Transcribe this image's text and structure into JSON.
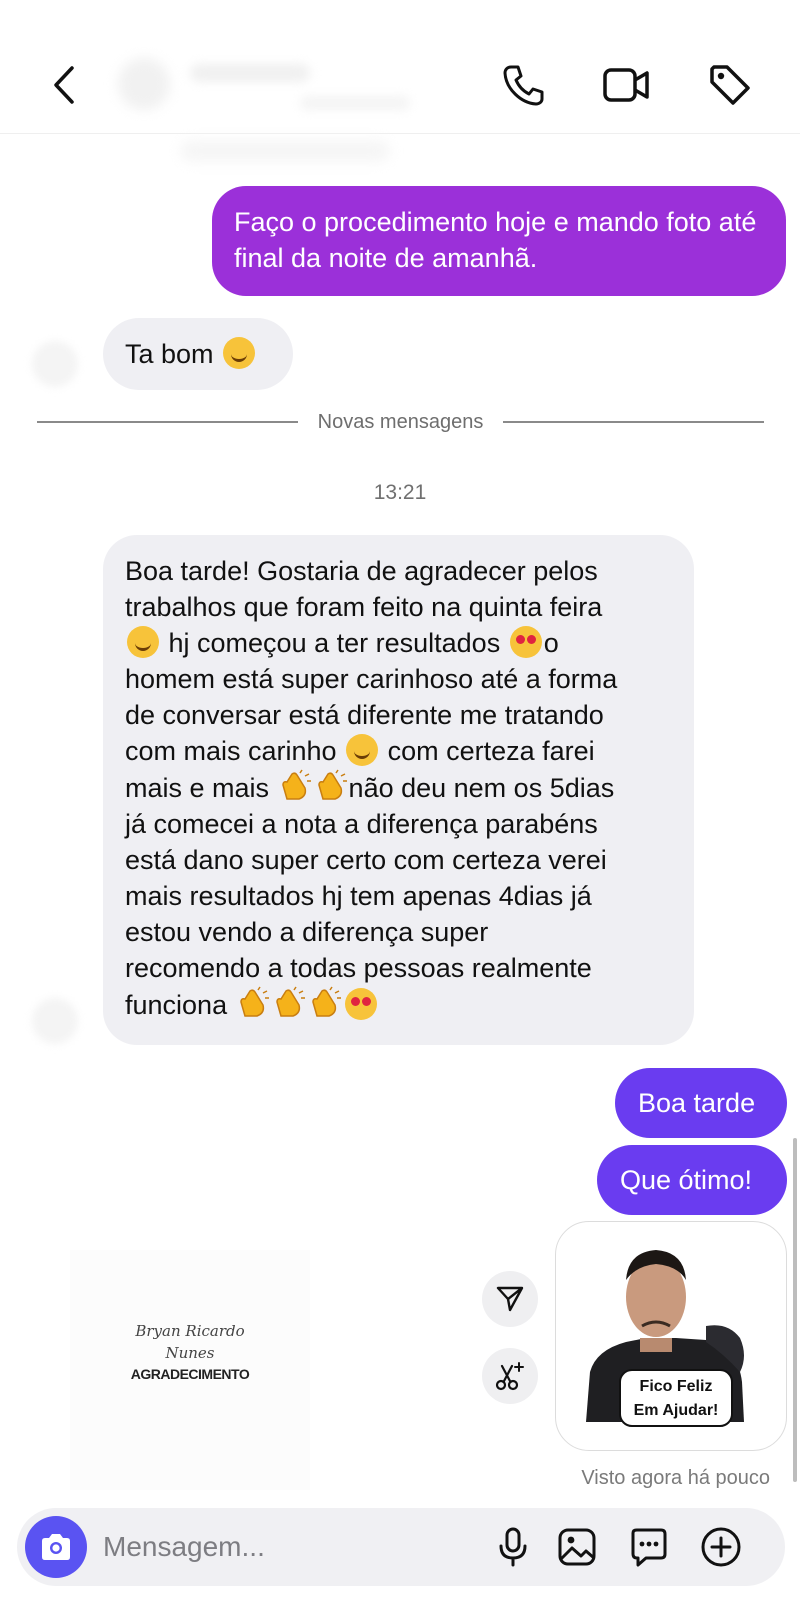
{
  "conversation": {
    "messages": [
      {
        "side": "out",
        "text": "Faço o procedimento hoje e mando foto até final da noite de amanhã."
      },
      {
        "side": "in",
        "text": "Ta bom"
      },
      {
        "side": "in",
        "text_lines": [
          "Boa tarde! Gostaria de agradecer pelos",
          "trabalhos que foram feito na quinta feira",
          "hj começou a ter resultados",
          "o",
          "homem está super carinhoso até a forma",
          "de conversar está diferente me tratando",
          "com mais carinho",
          "com certeza farei",
          "mais e mais",
          "não deu nem os 5dias",
          "já comecei a nota a diferença parabéns",
          "está dano super certo com certeza verei",
          "mais resultados hj tem apenas 4dias já",
          "estou vendo a diferença super",
          "recomendo a todas pessoas realmente",
          "funciona"
        ]
      },
      {
        "side": "out",
        "text": "Boa tarde"
      },
      {
        "side": "out",
        "text": "Que ótimo!"
      }
    ],
    "divider_label": "Novas mensagens",
    "time_label": "13:21",
    "sticker": {
      "line1": "Fico Feliz",
      "line2": "Em Ajudar!"
    },
    "brand": {
      "script1": "Bryan Ricardo",
      "script2": "Nunes",
      "caps": "AGRADECIMENTO"
    },
    "seen_label": "Visto agora há pouco"
  },
  "composer": {
    "placeholder": "Mensagem..."
  },
  "icons": [
    "back-arrow-icon",
    "phone-icon",
    "video-camera-icon",
    "tag-icon",
    "send-icon",
    "scissors-icon",
    "camera-icon",
    "microphone-icon",
    "image-icon",
    "sticker-chat-icon",
    "plus-circle-icon"
  ],
  "colors": {
    "outgoing_purple": "#9b30d9",
    "outgoing_violet": "#6a3cf0",
    "incoming": "#efeff3",
    "camera_button": "#5a53f2"
  }
}
